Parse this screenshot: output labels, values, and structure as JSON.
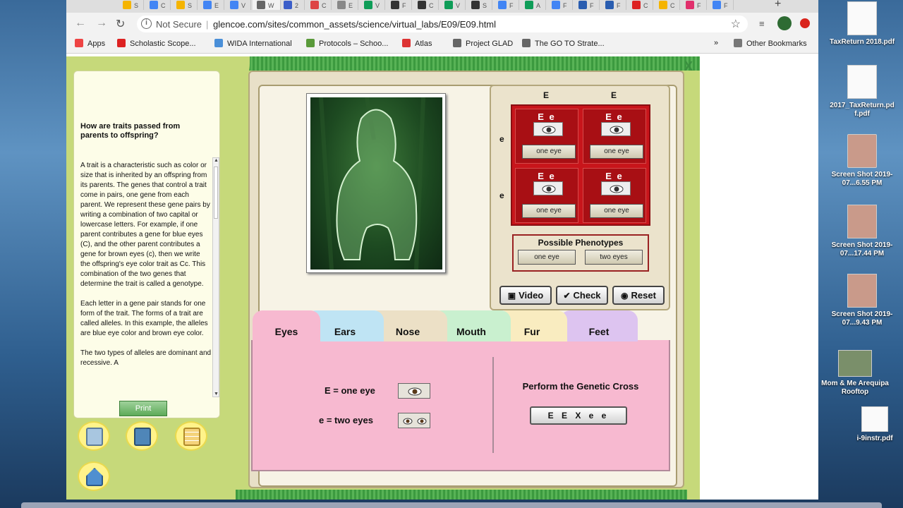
{
  "browser": {
    "tabs": [
      "S",
      "C",
      "S",
      "E",
      "V",
      "W",
      "2",
      "C",
      "E",
      "V",
      "F",
      "C",
      "V",
      "S",
      "F",
      "A",
      "F",
      "F",
      "F",
      "C",
      "C",
      "F",
      "F"
    ],
    "active_tab": "W",
    "omnibox": {
      "security": "Not Secure",
      "url": "glencoe.com/sites/common_assets/science/virtual_labs/E09/E09.html"
    },
    "bookmarks": [
      {
        "label": "Apps",
        "color": "#e44"
      },
      {
        "label": "Scholastic Scope...",
        "color": "#d22"
      },
      {
        "label": "WIDA International",
        "color": "#4a8fd8"
      },
      {
        "label": "Protocols – Schoo...",
        "color": "#5a9a3a"
      },
      {
        "label": "Atlas",
        "color": "#d33"
      },
      {
        "label": "Project GLAD",
        "color": "#666"
      },
      {
        "label": "The GO TO Strate...",
        "color": "#666"
      }
    ],
    "other_bookmarks": "Other Bookmarks",
    "more_bookmarks": "»"
  },
  "lab": {
    "close_label": "X",
    "left_panel": {
      "title": "How are traits passed from parents to offspring?",
      "paragraphs": [
        "A trait is a characteristic such as color or size that is inherited by an offspring from its parents. The genes that control a trait come in pairs, one gene from each parent. We represent these gene pairs by writing a combination of two capital or lowercase letters. For example, if one parent contributes a gene for blue eyes (C), and the other parent contributes a gene for brown eyes (c), then we write the offspring's eye color trait as Cc. This combination of the two genes that determine the trait is called a genotype.",
        "Each letter in a gene pair stands for one form of the trait. The forms of a trait are called alleles. In this example, the alleles are blue eye color and brown eye color.",
        "The two types of alleles are dominant and recessive. A"
      ],
      "print_label": "Print"
    },
    "tools": [
      {
        "name": "clipboard-icon",
        "color": "#8fb5d6"
      },
      {
        "name": "calculator-icon",
        "color": "#5a8fbf"
      },
      {
        "name": "table-icon",
        "color": "#f0c060"
      },
      {
        "name": "home-icon",
        "color": "#4f8fd0"
      }
    ],
    "punnett": {
      "top_alleles": [
        "E",
        "E"
      ],
      "side_alleles": [
        "e",
        "e"
      ],
      "cells": [
        {
          "genotype": "E e",
          "phenotype": "one eye"
        },
        {
          "genotype": "E e",
          "phenotype": "one eye"
        },
        {
          "genotype": "E e",
          "phenotype": "one eye"
        },
        {
          "genotype": "E e",
          "phenotype": "one eye"
        }
      ],
      "possible_title": "Possible Phenotypes",
      "possible": [
        "one eye",
        "two eyes"
      ]
    },
    "controls": {
      "video": "Video",
      "check": "Check",
      "reset": "Reset"
    },
    "trait_tabs": [
      {
        "label": "Eyes",
        "color": "#f7b9d0"
      },
      {
        "label": "Ears",
        "color": "#bfe4f4"
      },
      {
        "label": "Nose",
        "color": "#ece0c6"
      },
      {
        "label": "Mouth",
        "color": "#c9f0cf"
      },
      {
        "label": "Fur",
        "color": "#f9ecc0"
      },
      {
        "label": "Feet",
        "color": "#ddc4f0"
      }
    ],
    "key": [
      {
        "label": "E = one eye",
        "icon": "one-eye-icon"
      },
      {
        "label": "e = two eyes",
        "icon": "two-eyes-icon"
      }
    ],
    "cross": {
      "title": "Perform the Genetic Cross",
      "button": "E E X e e"
    }
  },
  "desktop": [
    {
      "label": "TaxReturn 2018.pdf"
    },
    {
      "label": "2017_TaxReturn.pd f.pdf"
    },
    {
      "label": "Screen Shot 2019-07...6.55 PM"
    },
    {
      "label": "Screen Shot 2019-07...17.44 PM"
    },
    {
      "label": "Screen Shot 2019-07...9.43 PM"
    },
    {
      "label": "Mom & Me Arequipa Rooftop"
    },
    {
      "label": "i-9instr.pdf"
    }
  ]
}
